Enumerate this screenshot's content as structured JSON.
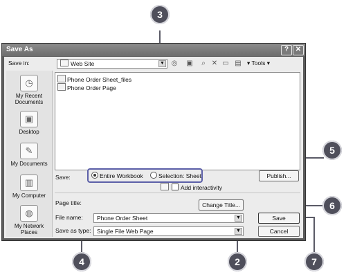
{
  "callouts": {
    "n3": "3",
    "n5": "5",
    "n6": "6",
    "n4": "4",
    "n2": "2",
    "n7": "7"
  },
  "dialog": {
    "title": "Save As",
    "help_glyph": "?",
    "close_glyph": "✕",
    "save_in_label": "Save in:",
    "save_in_value": "Web Site",
    "tools_label": "Tools"
  },
  "places": [
    {
      "label_line1": "My Recent",
      "label_line2": "Documents",
      "icon": "recent-documents-icon"
    },
    {
      "label_line1": "Desktop",
      "label_line2": "",
      "icon": "desktop-icon"
    },
    {
      "label_line1": "My Documents",
      "label_line2": "",
      "icon": "my-documents-icon"
    },
    {
      "label_line1": "My Computer",
      "label_line2": "",
      "icon": "my-computer-icon"
    },
    {
      "label_line1": "My Network",
      "label_line2": "Places",
      "icon": "network-places-icon"
    }
  ],
  "files": [
    {
      "name": "Phone Order Sheet_files",
      "icon": "folder-icon"
    },
    {
      "name": "Phone Order Page",
      "icon": "web-page-icon"
    }
  ],
  "options": {
    "save_label": "Save:",
    "entire_workbook": "Entire Workbook",
    "selection_sheet": "Selection: Sheet",
    "selected": "entire_workbook",
    "publish": "Publish...",
    "add_interactivity": "Add interactivity",
    "page_title_label": "Page title:",
    "change_title": "Change Title..."
  },
  "form": {
    "file_name_label": "File name:",
    "file_name_value": "Phone Order Sheet",
    "save_as_type_label": "Save as type:",
    "save_as_type_value": "Single File Web Page",
    "save_button": "Save",
    "cancel_button": "Cancel"
  },
  "colors": {
    "highlight": "#5b5fa8",
    "callout": "#4f4f5b"
  }
}
